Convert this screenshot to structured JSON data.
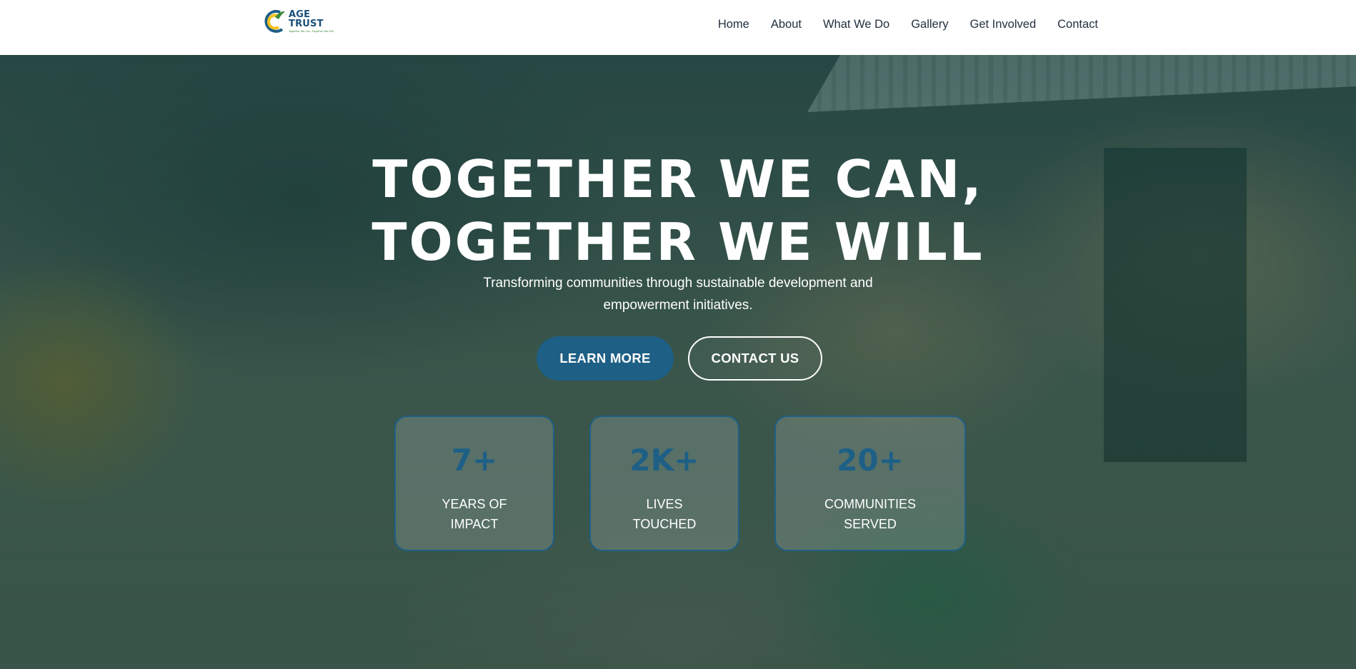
{
  "brand": {
    "name": "AGE TRUST",
    "tagline": "Together We Can, Together We Will",
    "colors": {
      "primary": "#1e5f86",
      "accent_yellow": "#f2c21a",
      "accent_green": "#3a8a3a"
    }
  },
  "nav": {
    "items": [
      {
        "label": "Home"
      },
      {
        "label": "About"
      },
      {
        "label": "What We Do"
      },
      {
        "label": "Gallery"
      },
      {
        "label": "Get Involved"
      },
      {
        "label": "Contact"
      }
    ]
  },
  "hero": {
    "title_line1": "TOGETHER WE CAN,",
    "title_line2": "TOGETHER WE WILL",
    "subtitle": "Transforming communities through sustainable development and empowerment initiatives.",
    "primary_button": "LEARN MORE",
    "secondary_button": "CONTACT US"
  },
  "stats": [
    {
      "value": "7+",
      "label": "YEARS OF IMPACT"
    },
    {
      "value": "2K+",
      "label": "LIVES TOUCHED"
    },
    {
      "value": "20+",
      "label": "COMMUNITIES SERVED"
    }
  ]
}
